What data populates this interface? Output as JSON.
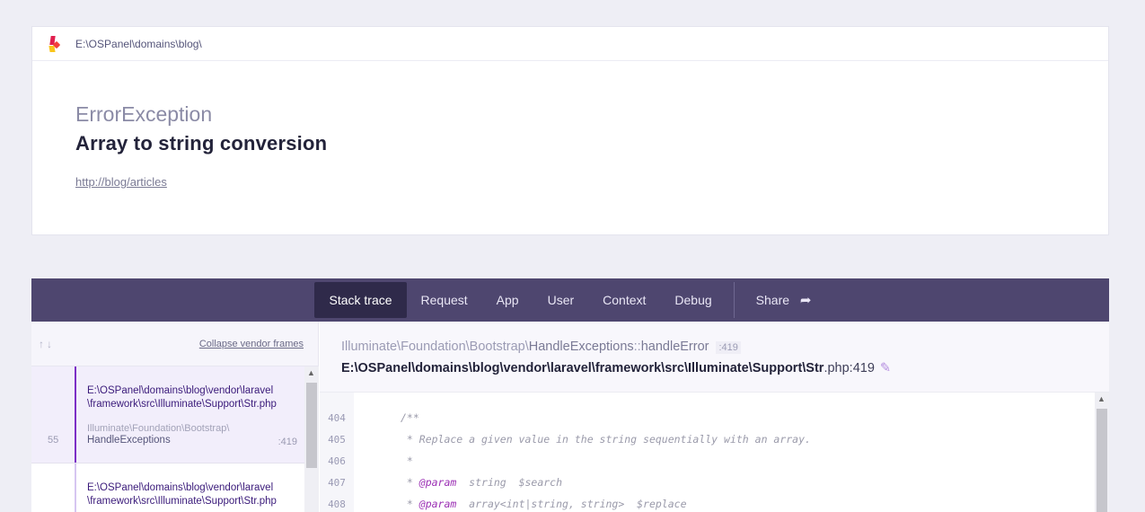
{
  "header": {
    "path": "E:\\OSPanel\\domains\\blog\\",
    "exception_class": "ErrorException",
    "message": "Array to string conversion",
    "url": "http://blog/articles"
  },
  "tabs": [
    {
      "label": "Stack trace",
      "active": true
    },
    {
      "label": "Request"
    },
    {
      "label": "App"
    },
    {
      "label": "User"
    },
    {
      "label": "Context"
    },
    {
      "label": "Debug"
    },
    {
      "label": "Share"
    }
  ],
  "frames_panel": {
    "collapse_label": "Collapse vendor frames",
    "frames": [
      {
        "file_line1": "E:\\OSPanel\\domains\\blog\\vendor\\laravel",
        "file_line2": "\\framework\\src\\Illuminate\\Support\\Str.php",
        "class": "Illuminate\\Foundation\\Bootstrap\\",
        "method": "HandleExceptions",
        "line": ":419",
        "number": "55"
      },
      {
        "file_line1": "E:\\OSPanel\\domains\\blog\\vendor\\laravel",
        "file_line2": "\\framework\\src\\Illuminate\\Support\\Str.php"
      }
    ]
  },
  "detail": {
    "class_prefix": "Illuminate\\Foundation\\Bootstrap\\",
    "class_name": "HandleExceptions",
    "separator": "::",
    "method": "handleError",
    "line": ":419",
    "file_bold": "E:\\OSPanel\\domains\\blog\\vendor\\laravel\\framework\\src\\Illuminate\\Support\\Str",
    "file_ext": ".php:419"
  },
  "code": [
    {
      "num": "404",
      "text": "/**"
    },
    {
      "num": "405",
      "text": " * Replace a given value in the string sequentially with an array."
    },
    {
      "num": "406",
      "text": " *"
    },
    {
      "num": "407",
      "tag": "@param",
      "text": "  string  $search"
    },
    {
      "num": "408",
      "tag": "@param",
      "text": "  array<int|string, string>  $replace"
    }
  ],
  "colors": {
    "accent": "#7c2ec6",
    "tabbar": "#4e466f",
    "tab_active": "#2f2a4a"
  }
}
